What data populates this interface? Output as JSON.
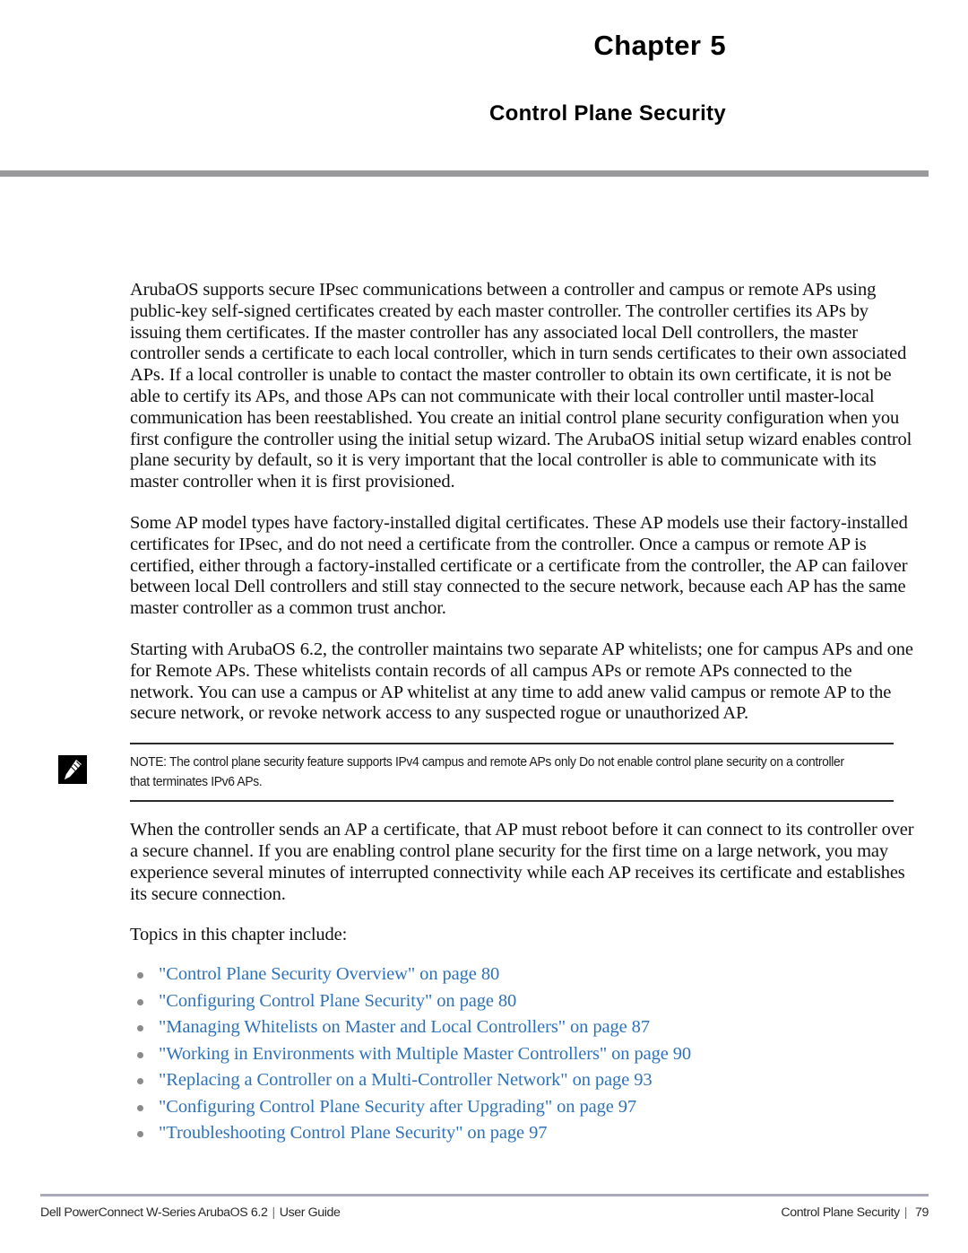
{
  "header": {
    "chapter_word": "Chapter",
    "chapter_number": "5",
    "chapter_title": "Control Plane Security"
  },
  "body": {
    "paragraph_1": "ArubaOS supports secure IPsec communications between a controller and campus or remote APs using public-key self-signed certificates created by each master controller. The controller certifies its APs by issuing them certificates. If the master controller has any associated local Dell controllers, the master controller sends a certificate to each local controller, which in turn sends certificates to their own associated APs. If a local controller is unable to contact the master controller to obtain its own certificate, it is not be able to certify its APs, and those APs can not communicate with their local controller until master-local communication has been reestablished. You create an initial control plane security configuration when you first configure the controller using the initial setup wizard. The ArubaOS initial setup wizard enables control plane security by default, so it is very important that the local controller is able to communicate with its master controller when it is first provisioned.",
    "paragraph_2": "Some AP model types have factory-installed digital certificates. These AP models use their factory-installed certificates for IPsec, and do not need a certificate from the controller. Once a campus or remote AP is certified, either through a factory-installed certificate or a certificate from the controller, the AP can failover between local Dell controllers and still stay connected to the secure network, because each AP has the same master controller as a common trust anchor.",
    "paragraph_3": "Starting with ArubaOS 6.2, the controller maintains two separate AP whitelists; one for campus APs and one for Remote APs. These whitelists contain records of all campus APs or remote APs connected to the network. You can use a campus or AP whitelist at any time to add anew valid campus or remote AP to the secure network, or revoke network access to any suspected rogue or unauthorized AP.",
    "paragraph_4": "When the controller sends an AP a certificate, that AP must reboot before it can connect to its controller over a secure channel. If you are enabling control plane security for the first time on a large network, you may experience several minutes of interrupted connectivity while each AP receives its certificate and establishes its secure connection.",
    "topics_intro": "Topics in this chapter include:"
  },
  "note": {
    "icon_name": "note-pencil-icon",
    "text": "NOTE: The control plane security feature supports IPv4 campus and remote APs only Do not enable control plane security on a controller that terminates IPv6 APs."
  },
  "topics": [
    {
      "label": "\"Control Plane Security Overview\" on page 80"
    },
    {
      "label": "\"Configuring Control Plane Security\" on page 80"
    },
    {
      "label": "\"Managing Whitelists on Master and Local Controllers\" on page 87"
    },
    {
      "label": "\"Working in Environments with Multiple Master Controllers\" on page 90"
    },
    {
      "label": "\"Replacing a Controller on a Multi-Controller Network\" on page 93"
    },
    {
      "label": "\"Configuring Control Plane Security after Upgrading\" on page 97"
    },
    {
      "label": "\"Troubleshooting Control Plane Security\" on page 97"
    }
  ],
  "footer": {
    "left_product": "Dell PowerConnect W-Series ArubaOS 6.2",
    "left_separator": "|",
    "left_doc": "User Guide",
    "right_section": "Control Plane Security",
    "right_separator": "|",
    "page_number": "79"
  },
  "colors": {
    "link_blue": "#2f72b8",
    "header_rule_gray": "#9a9a9d",
    "footer_rule": "#a9a9bb",
    "bullet_gray": "#8a8a8a"
  }
}
